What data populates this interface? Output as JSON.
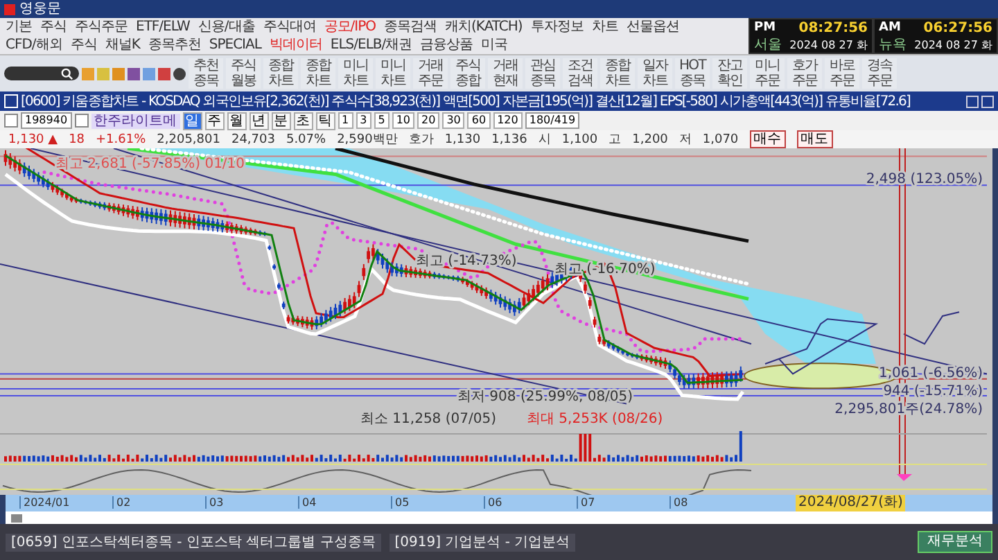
{
  "app": {
    "title": "영웅문"
  },
  "menu": [
    {
      "label": "기본",
      "highlight": false
    },
    {
      "label": "주식",
      "highlight": false
    },
    {
      "label": "주식주문",
      "highlight": false
    },
    {
      "label": "ETF/ELW",
      "highlight": false
    },
    {
      "label": "신용/대출",
      "highlight": false
    },
    {
      "label": "주식대여",
      "highlight": false
    },
    {
      "label": "공모/IPO",
      "highlight": true
    },
    {
      "label": "종목검색",
      "highlight": false
    },
    {
      "label": "캐치(KATCH)",
      "highlight": false
    },
    {
      "label": "투자정보",
      "highlight": false
    },
    {
      "label": "차트",
      "highlight": false
    },
    {
      "label": "선물옵션",
      "highlight": false
    },
    {
      "label": "CFD/해외",
      "highlight": false
    },
    {
      "label": "주식",
      "highlight": false
    },
    {
      "label": "채널K",
      "highlight": false
    },
    {
      "label": "종목추천",
      "highlight": false
    },
    {
      "label": "SPECIAL",
      "highlight": false
    },
    {
      "label": "빅데이터",
      "highlight": true
    },
    {
      "label": "ELS/ELB/채권",
      "highlight": false
    },
    {
      "label": "금융상품",
      "highlight": false
    },
    {
      "label": "미국",
      "highlight": false
    }
  ],
  "clocks": [
    {
      "ampm": "PM",
      "time": "08:27:56",
      "city": "서울",
      "date": "2024 08 27 화"
    },
    {
      "ampm": "AM",
      "time": "06:27:56",
      "city": "뉴욕",
      "date": "2024 08 27 화"
    }
  ],
  "toolbar": {
    "buttons": [
      [
        "추천",
        "종목"
      ],
      [
        "주식",
        "월봉"
      ],
      [
        "종합",
        "차트"
      ],
      [
        "종합",
        "차트"
      ],
      [
        "미니",
        "차트"
      ],
      [
        "미니",
        "차트"
      ],
      [
        "거래",
        "주문"
      ],
      [
        "주식",
        "종합"
      ],
      [
        "거래",
        "현재"
      ],
      [
        "관심",
        "종목"
      ],
      [
        "조건",
        "검색"
      ],
      [
        "종합",
        "차트"
      ],
      [
        "일자",
        "차트"
      ],
      [
        "HOT",
        "종목"
      ],
      [
        "잔고",
        "확인"
      ],
      [
        "미니",
        "주문"
      ],
      [
        "호가",
        "주문"
      ],
      [
        "바로",
        "주문"
      ],
      [
        "경속",
        "주문"
      ]
    ]
  },
  "window": {
    "title": "[0600] 키움종합차트 - KOSDAQ 외국인보유[2,362(천)] 주식수[38,923(천)] 액면[500] 자본금[195(억)] 결산[12월] EPS[-580] 시가총액[443(억)] 유통비율[72.6]"
  },
  "chart_toolbar": {
    "code": "198940",
    "name": "한주라이트메",
    "periods": [
      {
        "label": "일",
        "selected": true
      },
      {
        "label": "주",
        "selected": false
      },
      {
        "label": "월",
        "selected": false
      },
      {
        "label": "년",
        "selected": false
      },
      {
        "label": "분",
        "selected": false
      },
      {
        "label": "초",
        "selected": false
      },
      {
        "label": "틱",
        "selected": false
      }
    ],
    "intervals": [
      "1",
      "3",
      "5",
      "10",
      "20",
      "30",
      "60",
      "120"
    ],
    "count": "180/419"
  },
  "quote": [
    "1,130 ▲",
    "18",
    "+1.61%",
    "2,205,801",
    "24,703",
    "5.07%",
    "2,590백만",
    "호가",
    "1,130",
    "1,136",
    "시",
    "1,100",
    "고",
    "1,200",
    "저",
    "1,070"
  ],
  "quote_buttons": [
    "매수",
    "매도"
  ],
  "chart": {
    "labels": [
      {
        "text": "최고 2,681 (-57.85%) 01/10",
        "kind": "left"
      },
      {
        "text": "최고 (-14.73%)",
        "kind": "mid"
      },
      {
        "text": "최고 (-16.70%)",
        "kind": "mid"
      },
      {
        "text": "최저 908 (25.99%, 08/05)",
        "kind": "mid"
      },
      {
        "text": "최소 11,258 (07/05)",
        "kind": "mid"
      },
      {
        "text": "최대 5,253K (08/26)",
        "kind": "red"
      },
      {
        "text": "2,498 (123.05%)",
        "kind": "right"
      },
      {
        "text": "1,061 (-6.56%)",
        "kind": "right"
      },
      {
        "text": "944 (-15.71%)",
        "kind": "right"
      },
      {
        "text": "2,295,801주(24.78%)",
        "kind": "right"
      }
    ],
    "months": [
      "2024/01",
      "02",
      "03",
      "04",
      "05",
      "06",
      "07",
      "08"
    ],
    "cursor_date": "2024/08/27(화)"
  },
  "taskbar": [
    {
      "label": "[0659] 인포스탁섹터종목 - 인포스탁 섹터그룹별 구성종목"
    },
    {
      "label": "[0919] 기업분석 - 기업분석"
    }
  ],
  "taskbar_button": "재무분석"
}
